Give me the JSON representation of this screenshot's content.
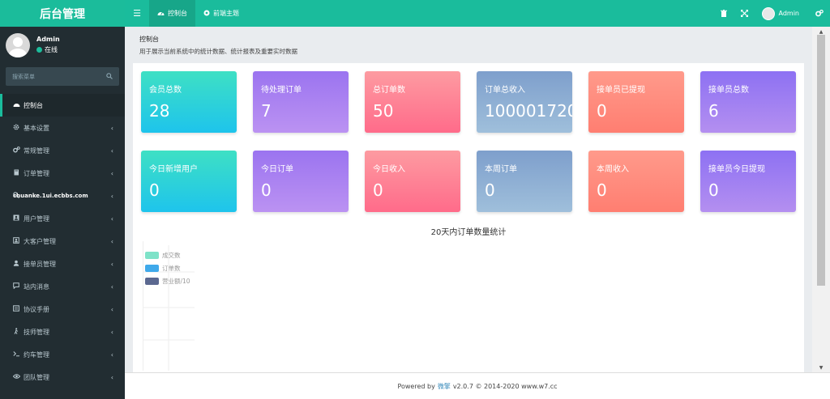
{
  "app": {
    "title": "后台管理"
  },
  "header": {
    "toggle_icon": "☰",
    "tabs": [
      {
        "label": "控制台",
        "icon": "dashboard-icon",
        "active": true
      },
      {
        "label": "前端主题",
        "icon": "circle-icon",
        "active": false
      }
    ],
    "user_name": "Admin"
  },
  "sidebar": {
    "user_name": "Admin",
    "status": "在线",
    "status_color": "#1bbc9b",
    "search_placeholder": "搜索菜单",
    "overlay_text": "chuanke.1ui.ecbbs.com",
    "items": [
      {
        "label": "控制台",
        "icon": "dashboard-icon",
        "active": true,
        "has_children": false
      },
      {
        "label": "基本设置",
        "icon": "gear-icon",
        "active": false,
        "has_children": true
      },
      {
        "label": "常规管理",
        "icon": "cogs-icon",
        "active": false,
        "has_children": true
      },
      {
        "label": "订单管理",
        "icon": "book-icon",
        "active": false,
        "has_children": true
      },
      {
        "label": "",
        "icon": "wrench-icon",
        "active": false,
        "has_children": true
      },
      {
        "label": "用户管理",
        "icon": "user-box-icon",
        "active": false,
        "has_children": true
      },
      {
        "label": "大客户管理",
        "icon": "portrait-icon",
        "active": false,
        "has_children": true
      },
      {
        "label": "接单员管理",
        "icon": "user-secret-icon",
        "active": false,
        "has_children": true
      },
      {
        "label": "站内消息",
        "icon": "chat-icon",
        "active": false,
        "has_children": true
      },
      {
        "label": "协议手册",
        "icon": "handbook-icon",
        "active": false,
        "has_children": true
      },
      {
        "label": "技师管理",
        "icon": "walker-icon",
        "active": false,
        "has_children": true
      },
      {
        "label": "约车管理",
        "icon": "terminal-icon",
        "active": false,
        "has_children": true
      },
      {
        "label": "团队管理",
        "icon": "eye-icon",
        "active": false,
        "has_children": true
      }
    ]
  },
  "page": {
    "title": "控制台",
    "subtitle": "用于展示当前系统中的统计数据、统计报表及重要实时数据"
  },
  "stats": [
    {
      "label": "会员总数",
      "value": "28"
    },
    {
      "label": "待处理订单",
      "value": "7"
    },
    {
      "label": "总订单数",
      "value": "50"
    },
    {
      "label": "订单总收入",
      "value": "100001720"
    },
    {
      "label": "接单员已提现",
      "value": "0"
    },
    {
      "label": "接单员总数",
      "value": "6"
    },
    {
      "label": "今日新增用户",
      "value": "0"
    },
    {
      "label": "今日订单",
      "value": "0"
    },
    {
      "label": "今日收入",
      "value": "0"
    },
    {
      "label": "本周订单",
      "value": "0"
    },
    {
      "label": "本周收入",
      "value": "0"
    },
    {
      "label": "接单员今日提现",
      "value": "0"
    }
  ],
  "chart": {
    "title": "20天内订单数量统计",
    "legend": [
      {
        "name": "成交数",
        "color": "#7ee2c8"
      },
      {
        "name": "订单数",
        "color": "#3fa9ea"
      },
      {
        "name": "营业额/10",
        "color": "#5b6890"
      }
    ]
  },
  "footer": {
    "prefix": "Powered by",
    "brand": "微擎",
    "suffix": "v2.0.7 © 2014-2020 www.w7.cc"
  }
}
